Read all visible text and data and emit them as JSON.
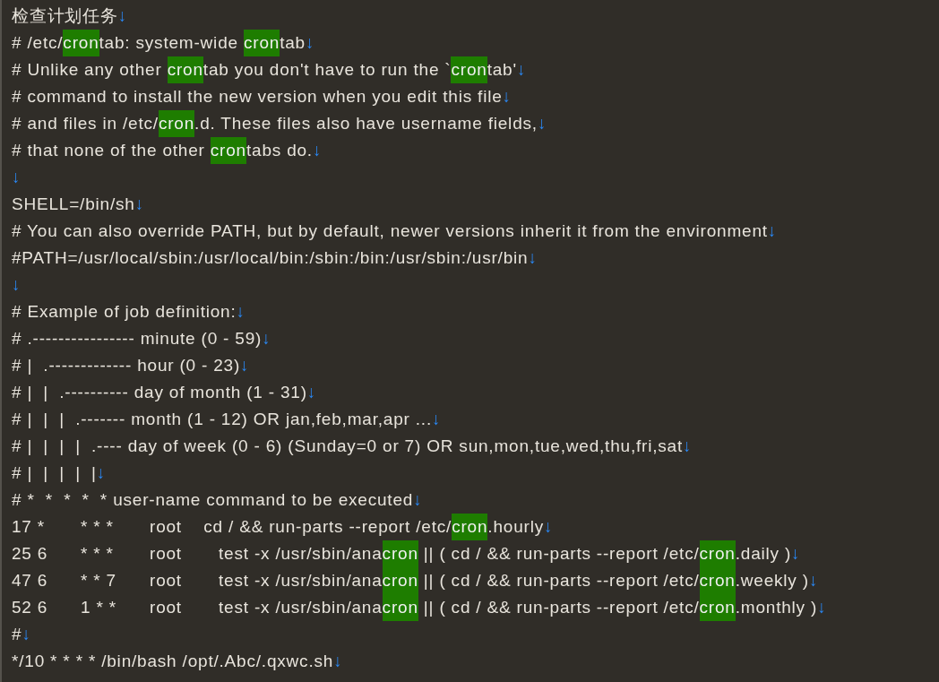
{
  "editor": {
    "end_mark": "↓",
    "lines": [
      {
        "kind": "text",
        "segments": [
          {
            "text": "检查计划任务",
            "highlighted": false
          }
        ]
      },
      {
        "kind": "text",
        "segments": [
          {
            "text": "# /etc/",
            "highlighted": false
          },
          {
            "text": "cron",
            "highlighted": true
          },
          {
            "text": "tab: system-wide ",
            "highlighted": false
          },
          {
            "text": "cron",
            "highlighted": true
          },
          {
            "text": "tab",
            "highlighted": false
          }
        ]
      },
      {
        "kind": "text",
        "segments": [
          {
            "text": "# Unlike any other ",
            "highlighted": false
          },
          {
            "text": "cron",
            "highlighted": true
          },
          {
            "text": "tab you don't have to run the `",
            "highlighted": false
          },
          {
            "text": "cron",
            "highlighted": true
          },
          {
            "text": "tab'",
            "highlighted": false
          }
        ]
      },
      {
        "kind": "text",
        "segments": [
          {
            "text": "# command to install the new version when you edit this file",
            "highlighted": false
          }
        ]
      },
      {
        "kind": "text",
        "segments": [
          {
            "text": "# and files in /etc/",
            "highlighted": false
          },
          {
            "text": "cron",
            "highlighted": true
          },
          {
            "text": ".d. These files also have username fields,",
            "highlighted": false
          }
        ]
      },
      {
        "kind": "text",
        "segments": [
          {
            "text": "# that none of the other ",
            "highlighted": false
          },
          {
            "text": "cron",
            "highlighted": true
          },
          {
            "text": "tabs do.",
            "highlighted": false
          }
        ]
      },
      {
        "kind": "blank"
      },
      {
        "kind": "text",
        "segments": [
          {
            "text": "SHELL=/bin/sh",
            "highlighted": false
          }
        ]
      },
      {
        "kind": "text",
        "segments": [
          {
            "text": "# You can also override PATH, but by default, newer versions inherit it from the environment",
            "highlighted": false
          }
        ]
      },
      {
        "kind": "text",
        "segments": [
          {
            "text": "#PATH=/usr/local/sbin:/usr/local/bin:/sbin:/bin:/usr/sbin:/usr/bin",
            "highlighted": false
          }
        ]
      },
      {
        "kind": "blank"
      },
      {
        "kind": "text",
        "segments": [
          {
            "text": "# Example of job definition:",
            "highlighted": false
          }
        ]
      },
      {
        "kind": "text",
        "segments": [
          {
            "text": "# .---------------- minute (0 - 59)",
            "highlighted": false
          }
        ]
      },
      {
        "kind": "text",
        "segments": [
          {
            "text": "# |  .------------- hour (0 - 23)",
            "highlighted": false
          }
        ]
      },
      {
        "kind": "text",
        "segments": [
          {
            "text": "# |  |  .---------- day of month (1 - 31)",
            "highlighted": false
          }
        ]
      },
      {
        "kind": "text",
        "segments": [
          {
            "text": "# |  |  |  .------- month (1 - 12) OR jan,feb,mar,apr ...",
            "highlighted": false
          }
        ]
      },
      {
        "kind": "text",
        "segments": [
          {
            "text": "# |  |  |  |  .---- day of week (0 - 6) (Sunday=0 or 7) OR sun,mon,tue,wed,thu,fri,sat",
            "highlighted": false
          }
        ]
      },
      {
        "kind": "text",
        "segments": [
          {
            "text": "# |  |  |  |  |",
            "highlighted": false
          }
        ]
      },
      {
        "kind": "text",
        "segments": [
          {
            "text": "# *  *  *  *  * user-name command to be executed",
            "highlighted": false
          }
        ]
      },
      {
        "kind": "text",
        "segments": [
          {
            "text": "17 *\t* * *\troot    cd / && run-parts --report /etc/",
            "highlighted": false
          },
          {
            "text": "cron",
            "highlighted": true
          },
          {
            "text": ".hourly",
            "highlighted": false
          }
        ]
      },
      {
        "kind": "text",
        "segments": [
          {
            "text": "25 6\t* * *\troot\ttest -x /usr/sbin/ana",
            "highlighted": false
          },
          {
            "text": "cron",
            "highlighted": true
          },
          {
            "text": " || ( cd / && run-parts --report /etc/",
            "highlighted": false
          },
          {
            "text": "cron",
            "highlighted": true
          },
          {
            "text": ".daily )",
            "highlighted": false
          }
        ]
      },
      {
        "kind": "text",
        "segments": [
          {
            "text": "47 6\t* * 7\troot\ttest -x /usr/sbin/ana",
            "highlighted": false
          },
          {
            "text": "cron",
            "highlighted": true
          },
          {
            "text": " || ( cd / && run-parts --report /etc/",
            "highlighted": false
          },
          {
            "text": "cron",
            "highlighted": true
          },
          {
            "text": ".weekly )",
            "highlighted": false
          }
        ]
      },
      {
        "kind": "text",
        "segments": [
          {
            "text": "52 6\t1 * *\troot\ttest -x /usr/sbin/ana",
            "highlighted": false
          },
          {
            "text": "cron",
            "highlighted": true
          },
          {
            "text": " || ( cd / && run-parts --report /etc/",
            "highlighted": false
          },
          {
            "text": "cron",
            "highlighted": true
          },
          {
            "text": ".monthly )",
            "highlighted": false
          }
        ]
      },
      {
        "kind": "text",
        "segments": [
          {
            "text": "#",
            "highlighted": false
          }
        ]
      },
      {
        "kind": "text",
        "segments": [
          {
            "text": "*/10 * * * * /bin/bash /opt/.Abc/.qxwc.sh",
            "highlighted": false
          }
        ]
      }
    ]
  }
}
